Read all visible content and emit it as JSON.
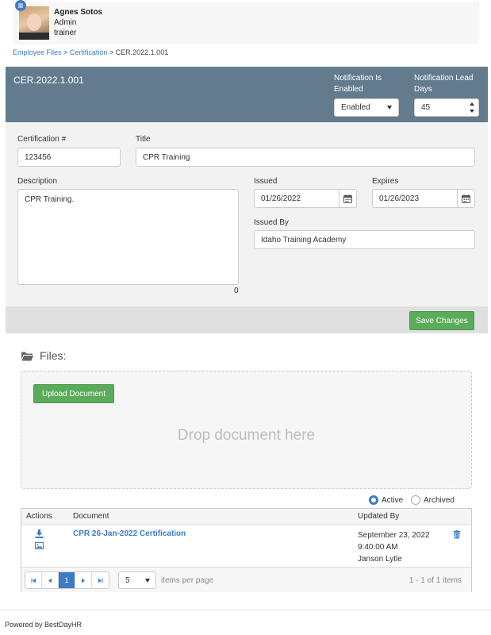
{
  "user": {
    "name": "Agnes Sotos",
    "role": "Admin",
    "title": "trainer"
  },
  "breadcrumb": {
    "items": [
      "Employee Files",
      "Certification"
    ],
    "separator": ">",
    "current": "CER.2022.1.001"
  },
  "header": {
    "cert_id": "CER.2022.1.001",
    "notification_enabled_label": "Notification Is Enabled",
    "notification_enabled_value": "Enabled",
    "lead_days_label": "Notification Lead Days",
    "lead_days_value": "45"
  },
  "form": {
    "cert_number_label": "Certification #",
    "cert_number_value": "123456",
    "title_label": "Title",
    "title_value": "CPR Training",
    "description_label": "Description",
    "description_value": "CPR Training.",
    "char_count": "0",
    "issued_label": "Issued",
    "issued_value": "01/26/2022",
    "expires_label": "Expires",
    "expires_value": "01/26/2023",
    "issued_by_label": "Issued By",
    "issued_by_value": "Idaho Training Academy"
  },
  "save_button": "Save Changes",
  "files": {
    "title": "Files:",
    "upload_button": "Upload Document",
    "drop_text": "Drop document here",
    "filter_active": "Active",
    "filter_archived": "Archived",
    "selected_filter": "Active",
    "columns": [
      "Actions",
      "Document",
      "Updated By"
    ],
    "rows": [
      {
        "document": "CPR 26-Jan-2022 Certification",
        "updated_date": "September 23, 2022",
        "updated_time": "9:40:00 AM",
        "updated_by": "Janson Lytle"
      }
    ],
    "pager": {
      "current_page": "1",
      "page_size": "5",
      "items_per_page_label": "items per page",
      "info": "1 - 1 of 1 items"
    }
  },
  "footer": "Powered by BestDayHR",
  "colors": {
    "header_bg": "#627c8e",
    "accent": "#3c7cc4",
    "success": "#5aab5a"
  }
}
